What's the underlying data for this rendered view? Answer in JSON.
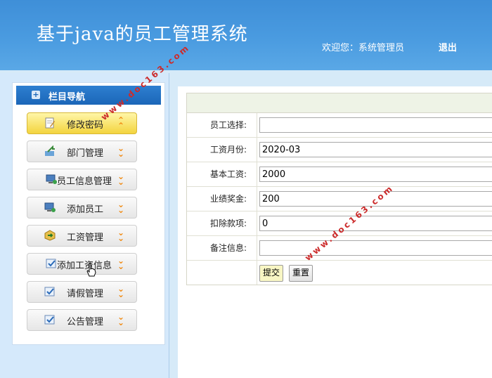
{
  "header": {
    "title": "基于java的员工管理系统",
    "welcome": "欢迎您：系统管理员",
    "logout": "退出"
  },
  "sidebar": {
    "heading": "栏目导航",
    "items": [
      {
        "label": "修改密码",
        "icon": "document-edit-icon",
        "active": true
      },
      {
        "label": "部门管理",
        "icon": "folder-arrow-icon"
      },
      {
        "label": "员工信息管理",
        "icon": "monitor-user-icon"
      },
      {
        "label": "添加员工",
        "icon": "monitor-user-icon"
      },
      {
        "label": "工资管理",
        "icon": "box-arrow-icon"
      },
      {
        "label": "添加工资信息",
        "icon": "checklist-icon"
      },
      {
        "label": "请假管理",
        "icon": "checklist-icon"
      },
      {
        "label": "公告管理",
        "icon": "checklist-icon"
      }
    ]
  },
  "form": {
    "fields": [
      {
        "label": "员工选择:",
        "value": ""
      },
      {
        "label": "工资月份:",
        "value": "2020-03"
      },
      {
        "label": "基本工资:",
        "value": "2000"
      },
      {
        "label": "业绩奖金:",
        "value": "200"
      },
      {
        "label": "扣除款项:",
        "value": "0"
      },
      {
        "label": "备注信息:",
        "value": ""
      }
    ],
    "submit": "提交",
    "reset": "重置"
  },
  "watermark": "www.doc163.com",
  "colors": {
    "header": "#4a9be0",
    "nav_heading": "#1b66b8",
    "active_item": "#f3d43e",
    "chevron": "#f08a12"
  }
}
